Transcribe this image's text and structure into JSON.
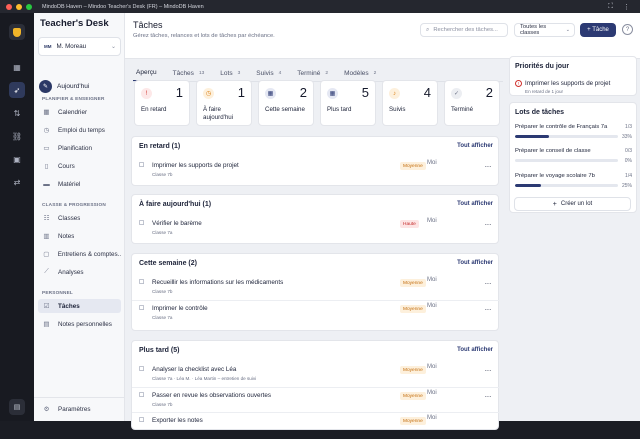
{
  "window": {
    "title": "MindoDB Haven – Mindoo Teacher's Desk (FR) – MindoDB Haven"
  },
  "sidebar": {
    "brand": "Teacher's Desk",
    "user": {
      "initials": "MM",
      "name": "M. Moreau"
    },
    "today_label": "Aujourd'hui",
    "sections": {
      "plan": "PLANIFIER & ENSEIGNER",
      "class": "CLASSE & PROGRESSION",
      "personal": "PERSONNEL"
    },
    "items": [
      {
        "label": "Calendrier",
        "icon": "calendar-icon"
      },
      {
        "label": "Emploi du temps",
        "icon": "timetable-icon"
      },
      {
        "label": "Planification",
        "icon": "planning-icon"
      },
      {
        "label": "Cours",
        "icon": "book-icon"
      },
      {
        "label": "Matériel",
        "icon": "folder-icon"
      },
      {
        "label": "Classes",
        "icon": "users-icon"
      },
      {
        "label": "Notes",
        "icon": "chart-icon"
      },
      {
        "label": "Entretiens & comptes...",
        "icon": "chat-icon"
      },
      {
        "label": "Analyses",
        "icon": "analytics-icon"
      },
      {
        "label": "Tâches",
        "icon": "checklist-icon"
      },
      {
        "label": "Notes personnelles",
        "icon": "note-icon"
      }
    ],
    "settings_label": "Paramètres"
  },
  "header": {
    "title": "Tâches",
    "subtitle": "Gérez tâches, relances et lots de tâches par échéance.",
    "search_placeholder": "Rechercher des tâches...",
    "class_filter": "Toutes les classes",
    "new_task_label": "+ Tâche"
  },
  "tabs": [
    {
      "label": "Aperçu",
      "count": ""
    },
    {
      "label": "Tâches",
      "count": "13"
    },
    {
      "label": "Lots",
      "count": "3"
    },
    {
      "label": "Suivis",
      "count": "4"
    },
    {
      "label": "Terminé",
      "count": "2"
    },
    {
      "label": "Modèles",
      "count": "2"
    }
  ],
  "stats": [
    {
      "label": "En retard",
      "value": "1",
      "icon": "alert-circle-icon",
      "color": "#d0312d",
      "bg": "#fde8e8"
    },
    {
      "label": "À faire aujourd'hui",
      "value": "1",
      "icon": "clock-icon",
      "color": "#d97706",
      "bg": "#fdf0dc"
    },
    {
      "label": "Cette semaine",
      "value": "2",
      "icon": "calendar-icon",
      "color": "#2c3a73",
      "bg": "#e5e8f3"
    },
    {
      "label": "Plus tard",
      "value": "5",
      "icon": "calendar-later-icon",
      "color": "#2c3a73",
      "bg": "#e5e8f3"
    },
    {
      "label": "Suivis",
      "value": "4",
      "icon": "bell-icon",
      "color": "#d97706",
      "bg": "#fdf0dc"
    },
    {
      "label": "Terminé",
      "value": "2",
      "icon": "check-circle-icon",
      "color": "#6a7085",
      "bg": "#eceef2"
    }
  ],
  "groups": [
    {
      "title": "En retard (1)",
      "action": "Tout afficher",
      "tasks": [
        {
          "title": "Imprimer les supports de projet",
          "class": "Classe 7b",
          "priority": "Moyenne",
          "level": "med",
          "due": "Moi"
        }
      ]
    },
    {
      "title": "À faire aujourd'hui (1)",
      "action": "Tout afficher",
      "tasks": [
        {
          "title": "Vérifier le barème",
          "class": "Classe 7a",
          "priority": "Haute",
          "level": "high",
          "due": "Moi"
        }
      ]
    },
    {
      "title": "Cette semaine (2)",
      "action": "Tout afficher",
      "tasks": [
        {
          "title": "Recueillir les informations sur les médicaments",
          "class": "Classe 7b",
          "priority": "Moyenne",
          "level": "med",
          "due": "Moi"
        },
        {
          "title": "Imprimer le contrôle",
          "class": "Classe 7a",
          "priority": "Moyenne",
          "level": "med",
          "due": "Moi"
        }
      ]
    },
    {
      "title": "Plus tard (5)",
      "action": "Tout afficher",
      "tasks": [
        {
          "title": "Analyser la checklist avec Léa",
          "class": "Classe 7a · Léa M. · Léa Martin – entretien de suivi",
          "priority": "Moyenne",
          "level": "med",
          "due": "Moi"
        },
        {
          "title": "Passer en revue les observations ouvertes",
          "class": "Classe 7b",
          "priority": "Moyenne",
          "level": "med",
          "due": "Moi"
        },
        {
          "title": "Exporter les notes",
          "class": "",
          "priority": "Moyenne",
          "level": "med",
          "due": "Moi"
        }
      ]
    }
  ],
  "priorities": {
    "title": "Priorités du jour",
    "item": {
      "title": "Imprimer les supports de projet",
      "sub": "En retard de 1 jour"
    }
  },
  "lots": {
    "title": "Lots de tâches",
    "items": [
      {
        "title": "Préparer le contrôle de Français 7a",
        "count": "1/3",
        "percent": "33%",
        "fraction": 0.33
      },
      {
        "title": "Préparer le conseil de classe",
        "count": "0/3",
        "percent": "0%",
        "fraction": 0
      },
      {
        "title": "Préparer le voyage scolaire 7b",
        "count": "1/4",
        "percent": "25%",
        "fraction": 0.25
      }
    ],
    "create_label": "Créer un lot"
  }
}
